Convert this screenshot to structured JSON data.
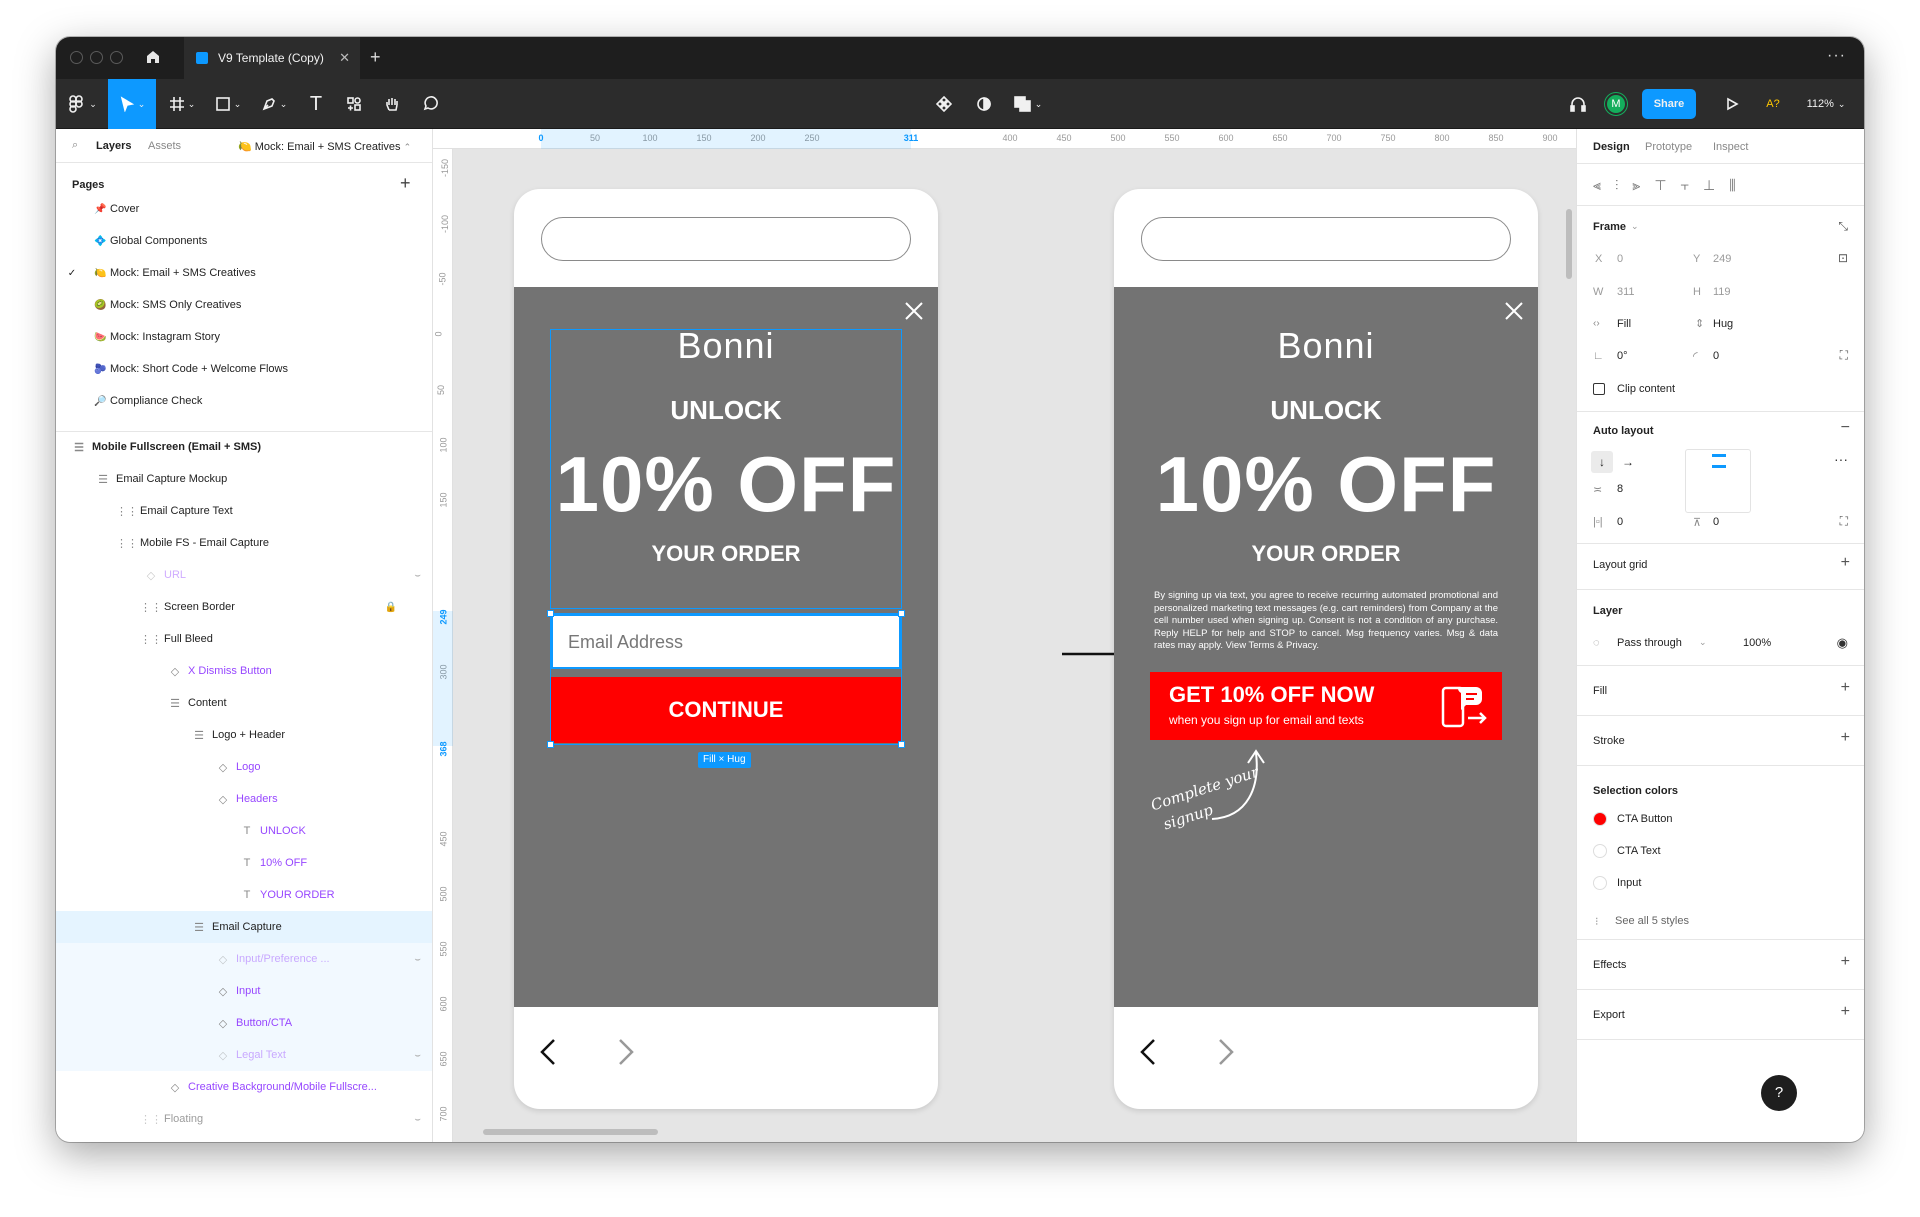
{
  "tab": {
    "title": "V9 Template (Copy)"
  },
  "toolbar": {
    "share_label": "Share",
    "avatar_initial": "M",
    "zoom": "112%",
    "a_label": "A?"
  },
  "left_panel": {
    "tabs": [
      "Layers",
      "Assets"
    ],
    "current_page_label": "Mock: Email + SMS Creatives",
    "pages_title": "Pages",
    "pages": [
      {
        "label": "Cover",
        "icon": "📌"
      },
      {
        "label": "Global Components",
        "icon": "💠"
      },
      {
        "label": "Mock: Email + SMS Creatives",
        "icon": "🍋",
        "selected": true
      },
      {
        "label": "Mock: SMS Only Creatives",
        "icon": "🥝"
      },
      {
        "label": "Mock: Instagram Story",
        "icon": "🍉"
      },
      {
        "label": "Mock: Short Code + Welcome Flows",
        "icon": "🫐"
      },
      {
        "label": "Compliance Check",
        "icon": "🔎"
      }
    ],
    "layers_root": "Mobile Fullscreen (Email + SMS)",
    "layers": [
      {
        "label": "Email Capture Mockup",
        "indent": 1,
        "kind": "frame"
      },
      {
        "label": "Email Capture Text",
        "indent": 2,
        "kind": "dashed"
      },
      {
        "label": "Mobile FS - Email Capture",
        "indent": 2,
        "kind": "dashed"
      },
      {
        "label": "URL",
        "indent": 3,
        "kind": "comp",
        "faded": true
      },
      {
        "label": "Screen Border",
        "indent": 3,
        "kind": "dashed",
        "lock": true
      },
      {
        "label": "Full Bleed",
        "indent": 3,
        "kind": "dashed"
      },
      {
        "label": "X Dismiss Button",
        "indent": 4,
        "kind": "comp"
      },
      {
        "label": "Content",
        "indent": 4,
        "kind": "frame"
      },
      {
        "label": "Logo + Header",
        "indent": 5,
        "kind": "frame"
      },
      {
        "label": "Logo",
        "indent": 6,
        "kind": "comp"
      },
      {
        "label": "Headers",
        "indent": 6,
        "kind": "comp"
      },
      {
        "label": "UNLOCK",
        "indent": 7,
        "kind": "text"
      },
      {
        "label": "10% OFF",
        "indent": 7,
        "kind": "text"
      },
      {
        "label": "YOUR ORDER",
        "indent": 7,
        "kind": "text"
      },
      {
        "label": "Email Capture",
        "indent": 5,
        "kind": "frame",
        "selected": true
      },
      {
        "label": "Input/Preference ...",
        "indent": 6,
        "kind": "comp",
        "faded": true,
        "sub": true
      },
      {
        "label": "Input",
        "indent": 6,
        "kind": "comp",
        "sub": true
      },
      {
        "label": "Button/CTA",
        "indent": 6,
        "kind": "comp",
        "sub": true
      },
      {
        "label": "Legal Text",
        "indent": 6,
        "kind": "comp",
        "faded": true,
        "sub": true
      },
      {
        "label": "Creative Background/Mobile Fullscre...",
        "indent": 4,
        "kind": "comp"
      },
      {
        "label": "Floating",
        "indent": 3,
        "kind": "dashed",
        "faded": true
      }
    ]
  },
  "ruler": {
    "top": [
      {
        "v": "0",
        "hl": true
      },
      {
        "v": "50"
      },
      {
        "v": "100"
      },
      {
        "v": "150"
      },
      {
        "v": "200"
      },
      {
        "v": "250"
      },
      {
        "v": "311",
        "hl": true
      },
      {
        "v": "400"
      },
      {
        "v": "450"
      },
      {
        "v": "500"
      },
      {
        "v": "550"
      },
      {
        "v": "600"
      },
      {
        "v": "650"
      },
      {
        "v": "700"
      },
      {
        "v": "750"
      },
      {
        "v": "800"
      },
      {
        "v": "850"
      },
      {
        "v": "900"
      }
    ],
    "left": [
      "-150",
      "-100",
      "-50",
      "0",
      "50",
      "100",
      "150",
      "249",
      "300",
      "368",
      "450",
      "500",
      "550",
      "600",
      "650",
      "700"
    ]
  },
  "mock_left": {
    "brand": "Bonni",
    "unlock": "UNLOCK",
    "off": "10% OFF",
    "your_order": "YOUR ORDER",
    "email_placeholder": "Email Address",
    "cta": "CONTINUE",
    "size_badge": "Fill × Hug"
  },
  "mock_right": {
    "brand": "Bonni",
    "unlock": "UNLOCK",
    "off": "10% OFF",
    "your_order": "YOUR ORDER",
    "legal": "By signing up via text, you agree to receive recurring automated promotional and personalized marketing text messages (e.g. cart reminders) from Company at the cell number used when signing up. Consent is not a condition of any purchase. Reply HELP for help and STOP to cancel. Msg frequency varies. Msg & data rates may apply. View Terms & Privacy.",
    "cta_main": "GET 10% OFF NOW",
    "cta_sub": "when you sign up for email and texts",
    "handwritten_1": "Complete your",
    "handwritten_2": "signup"
  },
  "right_panel": {
    "tabs": [
      "Design",
      "Prototype",
      "Inspect"
    ],
    "frame_title": "Frame",
    "x_label": "X",
    "x": "0",
    "y_label": "Y",
    "y": "249",
    "w_label": "W",
    "w": "311",
    "h_label": "H",
    "h": "119",
    "fill_mode": "Fill",
    "hug_mode": "Hug",
    "rotation": "0°",
    "radius": "0",
    "clip_content": "Clip content",
    "auto_layout": "Auto layout",
    "gap": "8",
    "pad_h": "0",
    "pad_v": "0",
    "layout_grid": "Layout grid",
    "layer": "Layer",
    "blend": "Pass through",
    "opacity": "100%",
    "fill": "Fill",
    "stroke": "Stroke",
    "selection_colors": "Selection colors",
    "colors": [
      {
        "name": "CTA Button",
        "hex": "#ff0000"
      },
      {
        "name": "CTA Text",
        "hex": "#ffffff"
      },
      {
        "name": "Input",
        "hex": "#ffffff"
      }
    ],
    "see_all": "See all 5 styles",
    "effects": "Effects",
    "export": "Export",
    "help": "?"
  },
  "colors": {
    "accent": "#0d99ff",
    "cta_red": "#ff0000",
    "creative_gray": "#737373",
    "component_purple": "#9747ff",
    "avatar_green": "#14ae5c"
  }
}
